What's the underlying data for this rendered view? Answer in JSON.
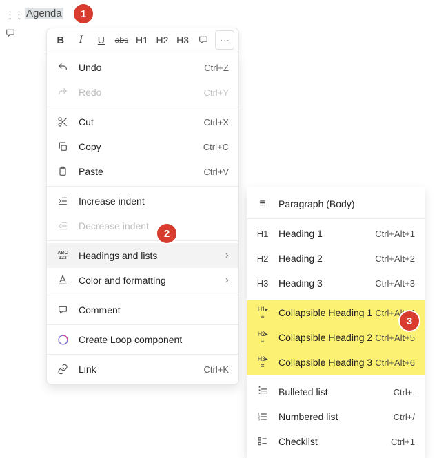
{
  "selection": {
    "text": "Agenda"
  },
  "callouts": {
    "c1": "1",
    "c2": "2",
    "c3": "3"
  },
  "toolbar": {
    "bold": "B",
    "italic": "I",
    "underline": "U",
    "strike": "abc",
    "h1": "H1",
    "h2": "H2",
    "h3": "H3",
    "comment": "",
    "overflow": "···"
  },
  "menu": {
    "undo": {
      "label": "Undo",
      "shortcut": "Ctrl+Z"
    },
    "redo": {
      "label": "Redo",
      "shortcut": "Ctrl+Y"
    },
    "cut": {
      "label": "Cut",
      "shortcut": "Ctrl+X"
    },
    "copy": {
      "label": "Copy",
      "shortcut": "Ctrl+C"
    },
    "paste": {
      "label": "Paste",
      "shortcut": "Ctrl+V"
    },
    "incIndent": {
      "label": "Increase indent"
    },
    "decIndent": {
      "label": "Decrease indent"
    },
    "headings": {
      "label": "Headings and lists"
    },
    "colorFmt": {
      "label": "Color and formatting"
    },
    "comment": {
      "label": "Comment"
    },
    "createLoop": {
      "label": "Create Loop component"
    },
    "link": {
      "label": "Link",
      "shortcut": "Ctrl+K"
    }
  },
  "submenu": {
    "paragraph": {
      "label": "Paragraph (Body)"
    },
    "h1": {
      "label": "Heading 1",
      "shortcut": "Ctrl+Alt+1",
      "iconText": "H1"
    },
    "h2": {
      "label": "Heading 2",
      "shortcut": "Ctrl+Alt+2",
      "iconText": "H2"
    },
    "h3": {
      "label": "Heading 3",
      "shortcut": "Ctrl+Alt+3",
      "iconText": "H3"
    },
    "ch1": {
      "label": "Collapsible Heading 1",
      "shortcut": "Ctrl+Alt+4"
    },
    "ch2": {
      "label": "Collapsible Heading 2",
      "shortcut": "Ctrl+Alt+5"
    },
    "ch3": {
      "label": "Collapsible Heading 3",
      "shortcut": "Ctrl+Alt+6"
    },
    "bulleted": {
      "label": "Bulleted list",
      "shortcut": "Ctrl+."
    },
    "numbered": {
      "label": "Numbered list",
      "shortcut": "Ctrl+/"
    },
    "checklist": {
      "label": "Checklist",
      "shortcut": "Ctrl+1"
    }
  }
}
